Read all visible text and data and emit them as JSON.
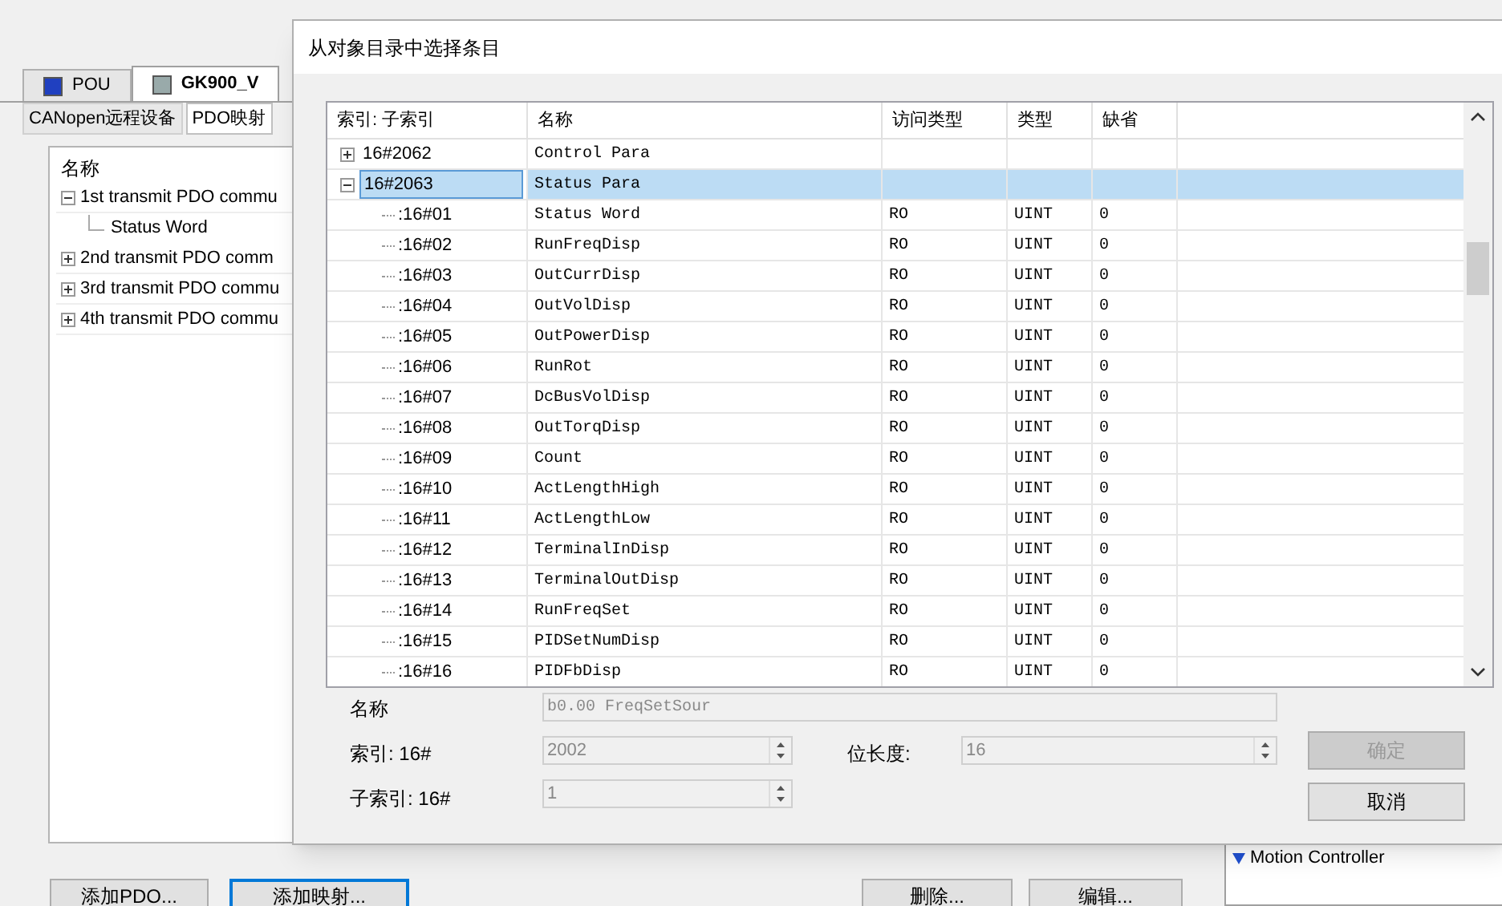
{
  "background": {
    "tabs": [
      {
        "label": "POU",
        "selected": false
      },
      {
        "label": "GK900_V",
        "selected": true
      }
    ],
    "subtabs": [
      {
        "label": "CANopen远程设备",
        "selected": false
      },
      {
        "label": "PDO映射",
        "selected": true
      }
    ],
    "pdo_tree": {
      "header": "名称",
      "items": [
        {
          "label": "1st transmit PDO commu",
          "expanded": true,
          "children": [
            {
              "label": "Status Word"
            }
          ]
        },
        {
          "label": "2nd transmit PDO comm",
          "expanded": false
        },
        {
          "label": "3rd transmit PDO commu",
          "expanded": false
        },
        {
          "label": "4th transmit PDO commu",
          "expanded": false
        }
      ]
    },
    "buttons": [
      {
        "label": "添加PDO...",
        "focused": false
      },
      {
        "label": "添加映射...",
        "focused": true
      },
      {
        "label": "删除...",
        "focused": false
      },
      {
        "label": "编辑...",
        "focused": false
      }
    ],
    "side_panel": {
      "title": "Motion Controller"
    }
  },
  "dialog": {
    "title": "从对象目录中选择条目",
    "columns": [
      "索引: 子索引",
      "名称",
      "访问类型",
      "类型",
      "缺省"
    ],
    "rows": [
      {
        "index": "16#2062",
        "name": "Control Para",
        "expanded": false,
        "selected": false
      },
      {
        "index": "16#2063",
        "name": "Status Para",
        "expanded": true,
        "selected": true,
        "children": [
          {
            "index": ":16#01",
            "name": "Status Word",
            "access": "RO",
            "type": "UINT",
            "default": "0"
          },
          {
            "index": ":16#02",
            "name": "RunFreqDisp",
            "access": "RO",
            "type": "UINT",
            "default": "0"
          },
          {
            "index": ":16#03",
            "name": "OutCurrDisp",
            "access": "RO",
            "type": "UINT",
            "default": "0"
          },
          {
            "index": ":16#04",
            "name": "OutVolDisp",
            "access": "RO",
            "type": "UINT",
            "default": "0"
          },
          {
            "index": ":16#05",
            "name": "OutPowerDisp",
            "access": "RO",
            "type": "UINT",
            "default": "0"
          },
          {
            "index": ":16#06",
            "name": "RunRot",
            "access": "RO",
            "type": "UINT",
            "default": "0"
          },
          {
            "index": ":16#07",
            "name": "DcBusVolDisp",
            "access": "RO",
            "type": "UINT",
            "default": "0"
          },
          {
            "index": ":16#08",
            "name": "OutTorqDisp",
            "access": "RO",
            "type": "UINT",
            "default": "0"
          },
          {
            "index": ":16#09",
            "name": "Count",
            "access": "RO",
            "type": "UINT",
            "default": "0"
          },
          {
            "index": ":16#10",
            "name": "ActLengthHigh",
            "access": "RO",
            "type": "UINT",
            "default": "0"
          },
          {
            "index": ":16#11",
            "name": "ActLengthLow",
            "access": "RO",
            "type": "UINT",
            "default": "0"
          },
          {
            "index": ":16#12",
            "name": "TerminalInDisp",
            "access": "RO",
            "type": "UINT",
            "default": "0"
          },
          {
            "index": ":16#13",
            "name": "TerminalOutDisp",
            "access": "RO",
            "type": "UINT",
            "default": "0"
          },
          {
            "index": ":16#14",
            "name": "RunFreqSet",
            "access": "RO",
            "type": "UINT",
            "default": "0"
          },
          {
            "index": ":16#15",
            "name": "PIDSetNumDisp",
            "access": "RO",
            "type": "UINT",
            "default": "0"
          },
          {
            "index": ":16#16",
            "name": "PIDFbDisp",
            "access": "RO",
            "type": "UINT",
            "default": "0"
          }
        ]
      }
    ],
    "form": {
      "name_label": "名称",
      "name_value": "b0.00 FreqSetSour",
      "index_label": "索引: 16#",
      "index_value": "2002",
      "bitlen_label": "位长度:",
      "bitlen_value": "16",
      "subindex_label": "子索引: 16#",
      "subindex_value": "1"
    },
    "buttons": [
      {
        "label": "确定",
        "disabled": true
      },
      {
        "label": "取消",
        "disabled": false
      }
    ]
  }
}
